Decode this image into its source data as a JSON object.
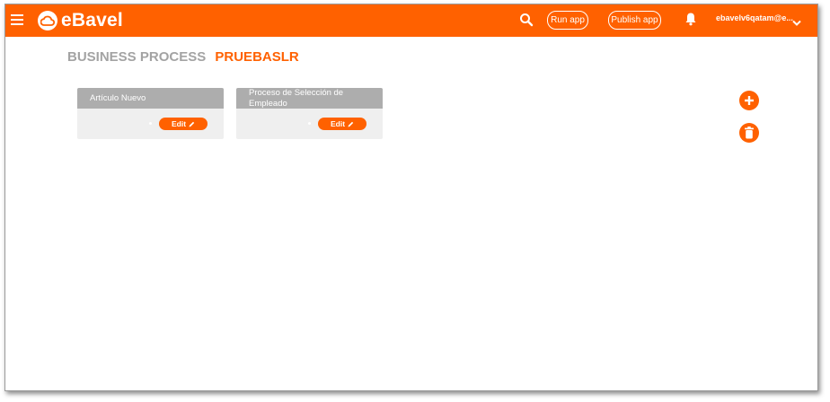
{
  "header": {
    "brand": "eBavel",
    "run_app": "Run app",
    "publish_app": "Publish app",
    "user": "ebavelv6qatam@e...",
    "brand_color": "#ff6100",
    "icons": [
      "menu-icon",
      "cloud-logo-icon",
      "search-icon",
      "bell-icon",
      "chevron-down-icon"
    ]
  },
  "breadcrumb": {
    "section": "BUSINESS PROCESS",
    "app": "PRUEBASLR"
  },
  "cards": [
    {
      "title": "Artículo Nuevo",
      "edit_label": "Edit"
    },
    {
      "title": "Proceso de Selección de Empleado",
      "edit_label": "Edit"
    }
  ],
  "actions": {
    "icons": [
      "add-circle-icon",
      "trash-icon"
    ]
  }
}
